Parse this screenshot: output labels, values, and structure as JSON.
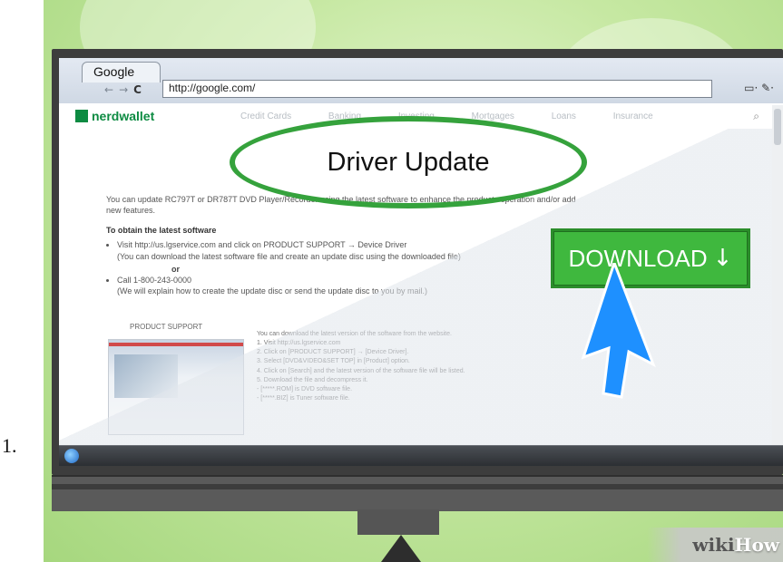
{
  "step": {
    "number": "1."
  },
  "browser": {
    "tab_title": "Google",
    "url": "http://google.com/",
    "nav_back": "←",
    "nav_forward": "→",
    "reload": "C",
    "page_menu": "▭·",
    "tools_menu": "✎·"
  },
  "website": {
    "logo": "nerdwallet",
    "nav_items": [
      "Credit Cards",
      "Banking",
      "Investing",
      "Mortgages",
      "Loans",
      "Insurance"
    ]
  },
  "callout": {
    "title": "Driver Update",
    "download_label": "DOWNLOAD",
    "download_arrow": "↓",
    "accent_color": "#35a23c",
    "pointer_color": "#1e90ff"
  },
  "page": {
    "intro": "You can update RC797T or DR787T DVD Player/Recorder using the latest software to enhance the products operation and/or add new features.",
    "section_title": "To obtain the latest software",
    "bullet1_line1": "Visit http://us.lgservice.com and click on PRODUCT SUPPORT → Device Driver",
    "bullet1_line2": "(You can download the latest software file and create an update disc using the downloaded file)",
    "or": "or",
    "bullet2_line1": "Call 1-800-243-0000",
    "bullet2_line2": "(We will explain how to create the update disc or send the update disc to you by mail.)",
    "product_support": "PRODUCT SUPPORT",
    "steps_intro": "You can download the latest version of the software from the website.",
    "steps": [
      "1. Visit http://us.lgservice.com",
      "2. Click on [PRODUCT SUPPORT] → [Device Driver].",
      "3. Select [DVD&VIDEO&SET TOP] in [Product] option.",
      "4. Click on [Search] and the latest version of the software file will be listed.",
      "5. Download the file and decompress it.",
      "   - [*****.ROM] is DVD software file.",
      "   - [*****.BIZ] is Tuner software file."
    ]
  },
  "watermark": {
    "part1": "wiki",
    "part2": "How"
  }
}
